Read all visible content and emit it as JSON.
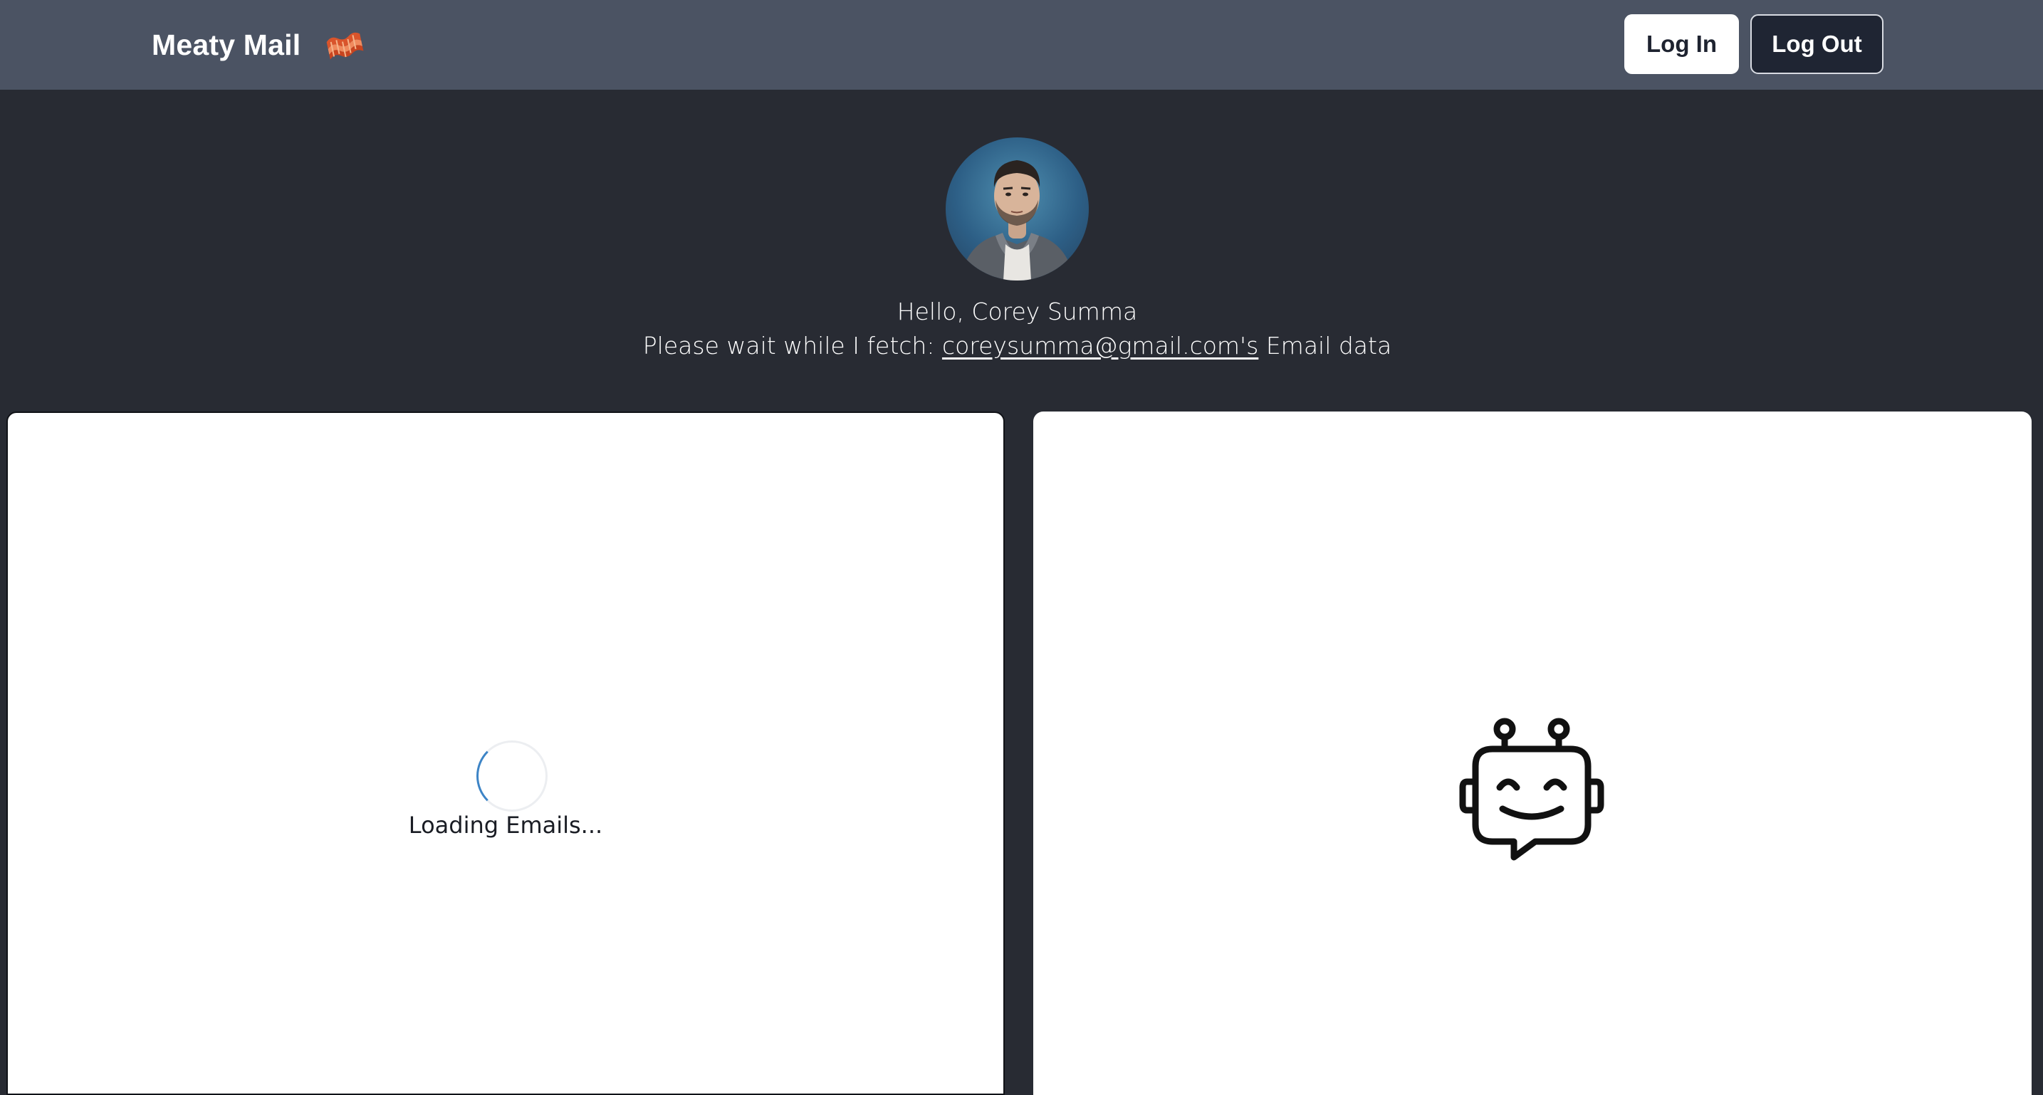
{
  "header": {
    "brand_name": "Meaty Mail",
    "logo_icon": "bacon-icon",
    "login_label": "Log In",
    "logout_label": "Log Out",
    "bar_color": "#4b5363"
  },
  "profile": {
    "avatar_icon": "user-avatar",
    "greeting": "Hello, Corey Summa",
    "fetch_prefix": "Please wait while I fetch: ",
    "email_link": "coreysumma@gmail.com's",
    "fetch_suffix": " Email data"
  },
  "emails_panel": {
    "loading_text": "Loading Emails...",
    "spinner_color": "#3d84c6"
  },
  "bot_panel": {
    "icon": "robot-chat-icon"
  },
  "colors": {
    "page_bg": "#282b33",
    "panel_bg": "#ffffff"
  }
}
